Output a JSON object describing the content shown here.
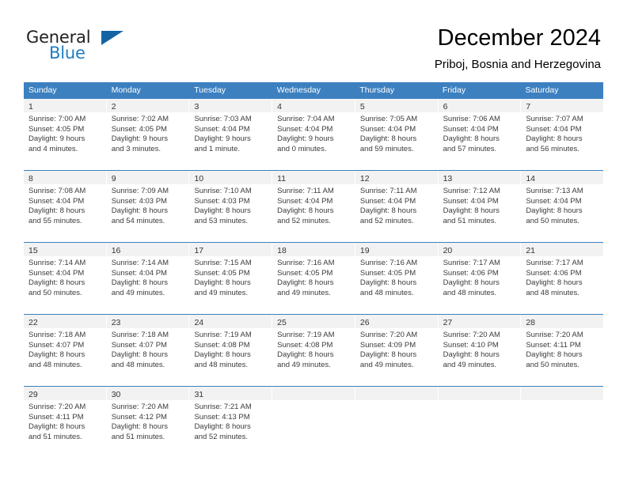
{
  "brand": {
    "name_top": "General",
    "name_bottom": "Blue",
    "color_dark": "#231f20",
    "color_blue": "#1f7dc4",
    "triangle_color": "#1464a5"
  },
  "header": {
    "title": "December 2024",
    "subtitle": "Priboj, Bosnia and Herzegovina"
  },
  "theme": {
    "header_band": "#3c80c0",
    "day_band": "#f2f2f2",
    "text": "#3b3b3b"
  },
  "weekdays": [
    "Sunday",
    "Monday",
    "Tuesday",
    "Wednesday",
    "Thursday",
    "Friday",
    "Saturday"
  ],
  "weeks": [
    [
      {
        "day": "1",
        "sunrise": "Sunrise: 7:00 AM",
        "sunset": "Sunset: 4:05 PM",
        "daylight1": "Daylight: 9 hours",
        "daylight2": "and 4 minutes."
      },
      {
        "day": "2",
        "sunrise": "Sunrise: 7:02 AM",
        "sunset": "Sunset: 4:05 PM",
        "daylight1": "Daylight: 9 hours",
        "daylight2": "and 3 minutes."
      },
      {
        "day": "3",
        "sunrise": "Sunrise: 7:03 AM",
        "sunset": "Sunset: 4:04 PM",
        "daylight1": "Daylight: 9 hours",
        "daylight2": "and 1 minute."
      },
      {
        "day": "4",
        "sunrise": "Sunrise: 7:04 AM",
        "sunset": "Sunset: 4:04 PM",
        "daylight1": "Daylight: 9 hours",
        "daylight2": "and 0 minutes."
      },
      {
        "day": "5",
        "sunrise": "Sunrise: 7:05 AM",
        "sunset": "Sunset: 4:04 PM",
        "daylight1": "Daylight: 8 hours",
        "daylight2": "and 59 minutes."
      },
      {
        "day": "6",
        "sunrise": "Sunrise: 7:06 AM",
        "sunset": "Sunset: 4:04 PM",
        "daylight1": "Daylight: 8 hours",
        "daylight2": "and 57 minutes."
      },
      {
        "day": "7",
        "sunrise": "Sunrise: 7:07 AM",
        "sunset": "Sunset: 4:04 PM",
        "daylight1": "Daylight: 8 hours",
        "daylight2": "and 56 minutes."
      }
    ],
    [
      {
        "day": "8",
        "sunrise": "Sunrise: 7:08 AM",
        "sunset": "Sunset: 4:04 PM",
        "daylight1": "Daylight: 8 hours",
        "daylight2": "and 55 minutes."
      },
      {
        "day": "9",
        "sunrise": "Sunrise: 7:09 AM",
        "sunset": "Sunset: 4:03 PM",
        "daylight1": "Daylight: 8 hours",
        "daylight2": "and 54 minutes."
      },
      {
        "day": "10",
        "sunrise": "Sunrise: 7:10 AM",
        "sunset": "Sunset: 4:03 PM",
        "daylight1": "Daylight: 8 hours",
        "daylight2": "and 53 minutes."
      },
      {
        "day": "11",
        "sunrise": "Sunrise: 7:11 AM",
        "sunset": "Sunset: 4:04 PM",
        "daylight1": "Daylight: 8 hours",
        "daylight2": "and 52 minutes."
      },
      {
        "day": "12",
        "sunrise": "Sunrise: 7:11 AM",
        "sunset": "Sunset: 4:04 PM",
        "daylight1": "Daylight: 8 hours",
        "daylight2": "and 52 minutes."
      },
      {
        "day": "13",
        "sunrise": "Sunrise: 7:12 AM",
        "sunset": "Sunset: 4:04 PM",
        "daylight1": "Daylight: 8 hours",
        "daylight2": "and 51 minutes."
      },
      {
        "day": "14",
        "sunrise": "Sunrise: 7:13 AM",
        "sunset": "Sunset: 4:04 PM",
        "daylight1": "Daylight: 8 hours",
        "daylight2": "and 50 minutes."
      }
    ],
    [
      {
        "day": "15",
        "sunrise": "Sunrise: 7:14 AM",
        "sunset": "Sunset: 4:04 PM",
        "daylight1": "Daylight: 8 hours",
        "daylight2": "and 50 minutes."
      },
      {
        "day": "16",
        "sunrise": "Sunrise: 7:14 AM",
        "sunset": "Sunset: 4:04 PM",
        "daylight1": "Daylight: 8 hours",
        "daylight2": "and 49 minutes."
      },
      {
        "day": "17",
        "sunrise": "Sunrise: 7:15 AM",
        "sunset": "Sunset: 4:05 PM",
        "daylight1": "Daylight: 8 hours",
        "daylight2": "and 49 minutes."
      },
      {
        "day": "18",
        "sunrise": "Sunrise: 7:16 AM",
        "sunset": "Sunset: 4:05 PM",
        "daylight1": "Daylight: 8 hours",
        "daylight2": "and 49 minutes."
      },
      {
        "day": "19",
        "sunrise": "Sunrise: 7:16 AM",
        "sunset": "Sunset: 4:05 PM",
        "daylight1": "Daylight: 8 hours",
        "daylight2": "and 48 minutes."
      },
      {
        "day": "20",
        "sunrise": "Sunrise: 7:17 AM",
        "sunset": "Sunset: 4:06 PM",
        "daylight1": "Daylight: 8 hours",
        "daylight2": "and 48 minutes."
      },
      {
        "day": "21",
        "sunrise": "Sunrise: 7:17 AM",
        "sunset": "Sunset: 4:06 PM",
        "daylight1": "Daylight: 8 hours",
        "daylight2": "and 48 minutes."
      }
    ],
    [
      {
        "day": "22",
        "sunrise": "Sunrise: 7:18 AM",
        "sunset": "Sunset: 4:07 PM",
        "daylight1": "Daylight: 8 hours",
        "daylight2": "and 48 minutes."
      },
      {
        "day": "23",
        "sunrise": "Sunrise: 7:18 AM",
        "sunset": "Sunset: 4:07 PM",
        "daylight1": "Daylight: 8 hours",
        "daylight2": "and 48 minutes."
      },
      {
        "day": "24",
        "sunrise": "Sunrise: 7:19 AM",
        "sunset": "Sunset: 4:08 PM",
        "daylight1": "Daylight: 8 hours",
        "daylight2": "and 48 minutes."
      },
      {
        "day": "25",
        "sunrise": "Sunrise: 7:19 AM",
        "sunset": "Sunset: 4:08 PM",
        "daylight1": "Daylight: 8 hours",
        "daylight2": "and 49 minutes."
      },
      {
        "day": "26",
        "sunrise": "Sunrise: 7:20 AM",
        "sunset": "Sunset: 4:09 PM",
        "daylight1": "Daylight: 8 hours",
        "daylight2": "and 49 minutes."
      },
      {
        "day": "27",
        "sunrise": "Sunrise: 7:20 AM",
        "sunset": "Sunset: 4:10 PM",
        "daylight1": "Daylight: 8 hours",
        "daylight2": "and 49 minutes."
      },
      {
        "day": "28",
        "sunrise": "Sunrise: 7:20 AM",
        "sunset": "Sunset: 4:11 PM",
        "daylight1": "Daylight: 8 hours",
        "daylight2": "and 50 minutes."
      }
    ],
    [
      {
        "day": "29",
        "sunrise": "Sunrise: 7:20 AM",
        "sunset": "Sunset: 4:11 PM",
        "daylight1": "Daylight: 8 hours",
        "daylight2": "and 51 minutes."
      },
      {
        "day": "30",
        "sunrise": "Sunrise: 7:20 AM",
        "sunset": "Sunset: 4:12 PM",
        "daylight1": "Daylight: 8 hours",
        "daylight2": "and 51 minutes."
      },
      {
        "day": "31",
        "sunrise": "Sunrise: 7:21 AM",
        "sunset": "Sunset: 4:13 PM",
        "daylight1": "Daylight: 8 hours",
        "daylight2": "and 52 minutes."
      },
      {
        "day": "",
        "sunrise": "",
        "sunset": "",
        "daylight1": "",
        "daylight2": ""
      },
      {
        "day": "",
        "sunrise": "",
        "sunset": "",
        "daylight1": "",
        "daylight2": ""
      },
      {
        "day": "",
        "sunrise": "",
        "sunset": "",
        "daylight1": "",
        "daylight2": ""
      },
      {
        "day": "",
        "sunrise": "",
        "sunset": "",
        "daylight1": "",
        "daylight2": ""
      }
    ]
  ]
}
